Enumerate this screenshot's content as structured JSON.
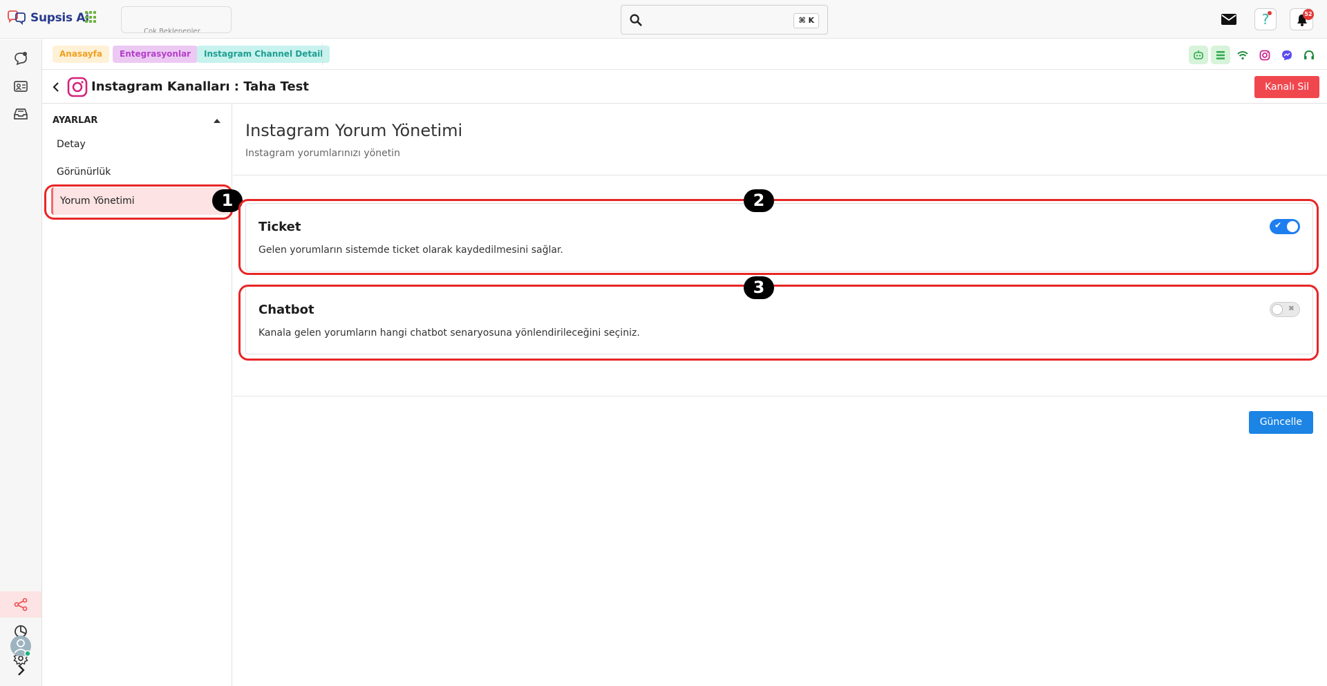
{
  "topbar": {
    "brand_name": "Supsis Ai",
    "quick_box_text": "Çok Beklenenler",
    "search_shortcut": "⌘ K",
    "notification_count": "52"
  },
  "breadcrumbs": [
    "Anasayfa",
    "Entegrasyonlar",
    "Instagram Channel Detail"
  ],
  "channel_header": {
    "title": "Instagram Kanalları : Taha Test",
    "delete_label": "Kanalı Sil"
  },
  "settings": {
    "title": "AYARLAR",
    "items": [
      {
        "label": "Detay",
        "active": false
      },
      {
        "label": "Görünürlük",
        "active": false
      },
      {
        "label": "Yorum Yönetimi",
        "active": true
      }
    ]
  },
  "content": {
    "title": "Instagram Yorum Yönetimi",
    "subtitle": "Instagram yorumlarınızı yönetin",
    "cards": [
      {
        "title": "Ticket",
        "description": "Gelen yorumların sistemde ticket olarak kaydedilmesini sağlar.",
        "enabled": true
      },
      {
        "title": "Chatbot",
        "description": "Kanala gelen yorumların hangi chatbot senaryosuna yönlendirileceğini seçiniz.",
        "enabled": false
      }
    ],
    "update_label": "Güncelle"
  },
  "annotations": [
    "1",
    "2",
    "3"
  ],
  "colors": {
    "accent_red": "#f0474f",
    "accent_blue": "#1c84e4",
    "annotation_red": "#e82525",
    "active_bg": "#fde3e3"
  }
}
